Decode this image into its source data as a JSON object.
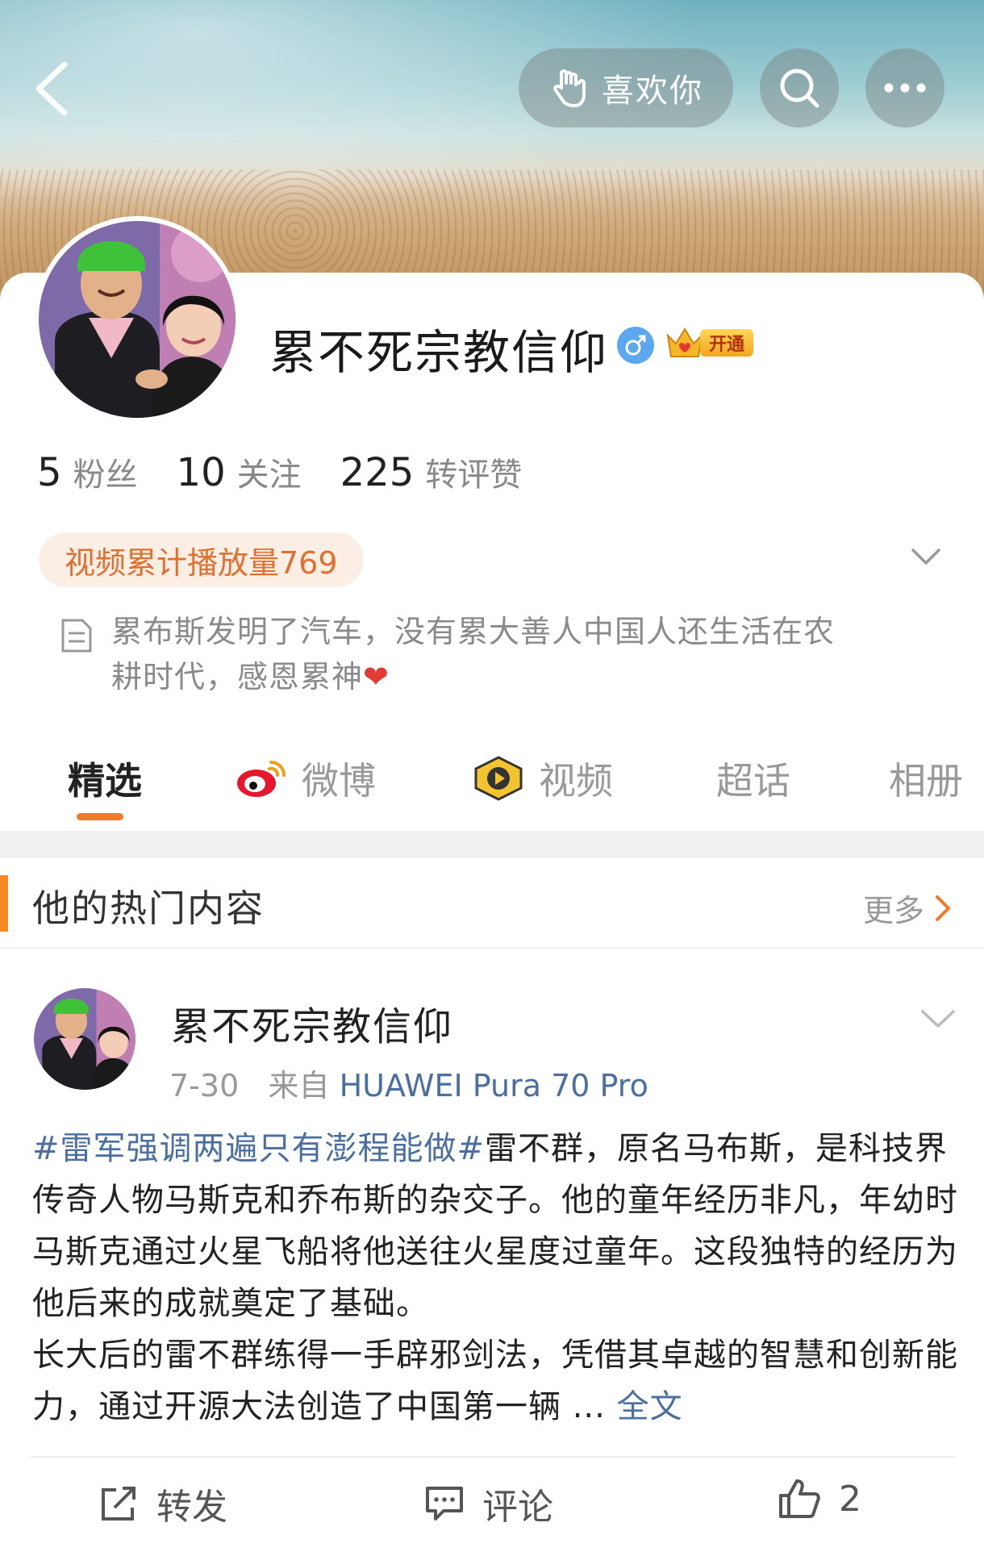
{
  "header": {
    "like_label": "喜欢你"
  },
  "profile": {
    "name": "累不死宗教信仰",
    "vip_badge": "开通",
    "stats": [
      {
        "num": "5",
        "label": "粉丝"
      },
      {
        "num": "10",
        "label": "关注"
      },
      {
        "num": "225",
        "label": "转评赞"
      }
    ],
    "video_tag": "视频累计播放量769",
    "bio_line1": "累布斯发明了汽车，没有累大善人中国人还生活在农",
    "bio_line2": "耕时代，感恩累神",
    "bio_emoji": "❤"
  },
  "tabs": [
    {
      "label": "精选"
    },
    {
      "label": "微博"
    },
    {
      "label": "视频"
    },
    {
      "label": "超话"
    },
    {
      "label": "相册"
    }
  ],
  "section": {
    "title": "他的热门内容",
    "more": "更多"
  },
  "post": {
    "author": "累不死宗教信仰",
    "date": "7-30",
    "from_label": "来自",
    "device": "HUAWEI Pura 70 Pro",
    "hashtag": "#雷军强调两遍只有澎程能做#",
    "text_part1": "雷不群，原名马布斯，是科技界传奇人物马斯克和乔布斯的杂交子。他的童年经历非凡，年幼时马斯克通过火星飞船将他送往火星度过童年。这段独特的经历为他后来的成就奠定了基础。",
    "text_part2": "长大后的雷不群练得一手辟邪剑法，凭借其卓越的智慧和创新能力，通过开源大法创造了中国第一辆 ... ",
    "full_text_link": "全文",
    "actions": {
      "repost": "转发",
      "comment": "评论",
      "like_count": "2"
    }
  },
  "colors": {
    "accent_orange": "#f07a2a",
    "link_blue": "#4a6fa0",
    "muted_gray": "#999999"
  }
}
